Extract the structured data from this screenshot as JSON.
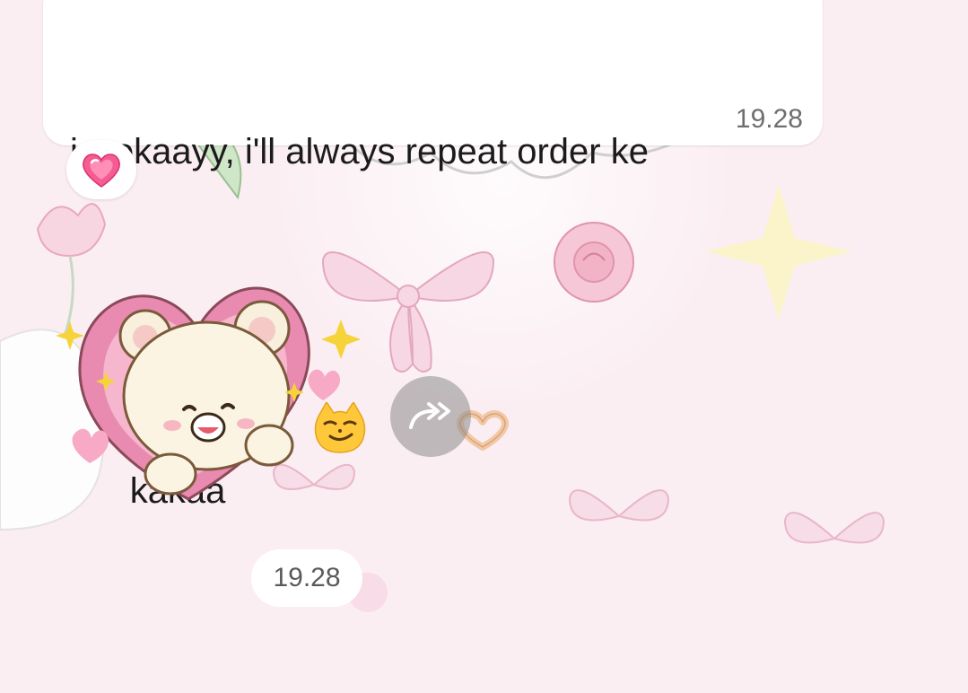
{
  "message": {
    "line1": "issokaayy, i'll always repeat order ke",
    "line2": "kakaa",
    "emojis": [
      "smirking-cat-face",
      "heart-hands"
    ],
    "time": "19.28"
  },
  "reaction": {
    "emoji": "growing-heart"
  },
  "sticker": {
    "name": "bear-holding-pink-heart",
    "time": "19.28"
  },
  "forward": {
    "icon": "forward-arrow-icon"
  },
  "colors": {
    "wallpaper": "#fbeef2",
    "bubble": "#ffffff",
    "text": "#1b1b1b",
    "time": "#6e6e6e",
    "sticker_heart": "#e98bb0"
  }
}
